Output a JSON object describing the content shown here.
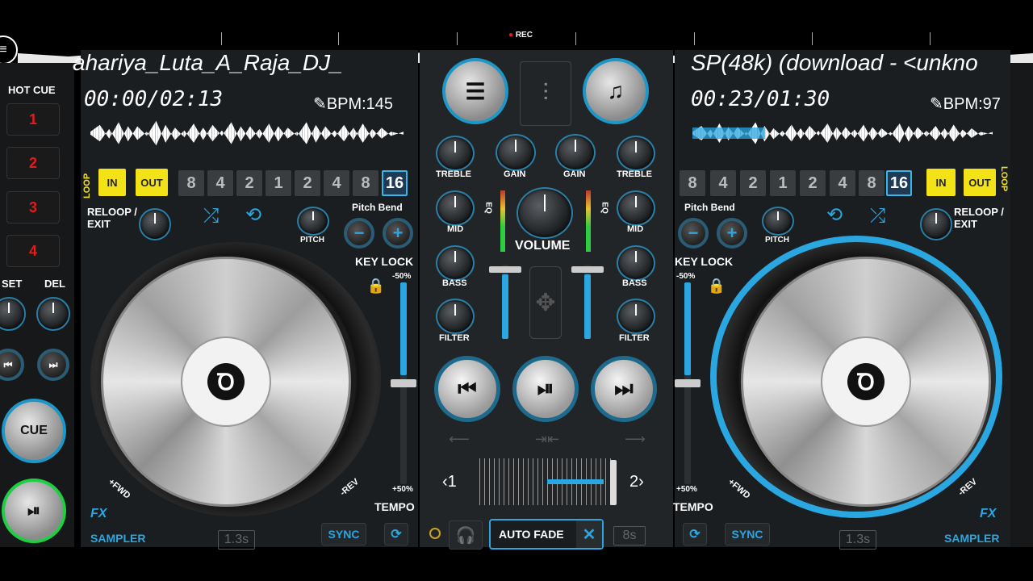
{
  "header": {
    "rec_label": "REC"
  },
  "deck_a": {
    "title": "ahariya_Luta_A_Raja_DJ_",
    "time": "00:00/02:13",
    "bpm": "BPM:145",
    "in_label": "IN",
    "out_label": "OUT",
    "loop_label": "LOOP",
    "loop_values": [
      "8",
      "4",
      "2",
      "1",
      "2",
      "4",
      "8",
      "16"
    ],
    "reloop_label": "RELOOP / EXIT",
    "pitch_label": "PITCH",
    "pitch_bend_label": "Pitch Bend",
    "key_lock_label": "KEY LOCK",
    "pitch_max": "-50%",
    "pitch_min": "+50%",
    "tempo_label": "TEMPO",
    "fwd_label": "+FWD",
    "rev_label": "-REV",
    "fx_label": "FX",
    "sampler_label": "SAMPLER",
    "time_box": "1.3s",
    "sync_label": "SYNC"
  },
  "deck_b": {
    "title": "SP(48k) (download - <unkno",
    "time": "00:23/01:30",
    "bpm": "BPM:97",
    "in_label": "IN",
    "out_label": "OUT",
    "loop_label": "LOOP",
    "loop_values": [
      "8",
      "4",
      "2",
      "1",
      "2",
      "4",
      "8",
      "16"
    ],
    "reloop_label": "RELOOP / EXIT",
    "pitch_label": "PITCH",
    "pitch_bend_label": "Pitch Bend",
    "key_lock_label": "KEY LOCK",
    "pitch_max": "-50%",
    "pitch_min": "+50%",
    "tempo_label": "TEMPO",
    "fwd_label": "+FWD",
    "rev_label": "-REV",
    "fx_label": "FX",
    "sampler_label": "SAMPLER",
    "time_box": "1.3s",
    "sync_label": "SYNC"
  },
  "hot_cue": {
    "label": "HOT CUE",
    "pads": [
      "1",
      "2",
      "3",
      "4"
    ],
    "set_label": "SET",
    "del_label": "DEL",
    "cue_label": "CUE"
  },
  "mixer": {
    "treble_label": "TREBLE",
    "gain_label": "GAIN",
    "mid_label": "MID",
    "bass_label": "BASS",
    "filter_label": "FILTER",
    "eq_label": "EQ",
    "volume_label": "VOLUME",
    "crossfader_left": "‹1",
    "crossfader_right": "2›",
    "auto_fade_label": "AUTO FADE",
    "auto_fade_time": "8s"
  },
  "colors": {
    "accent": "#2aa6e0",
    "yellow": "#f3e316",
    "hotcue_red": "#e31b1b",
    "panel": "#1b1e21"
  }
}
